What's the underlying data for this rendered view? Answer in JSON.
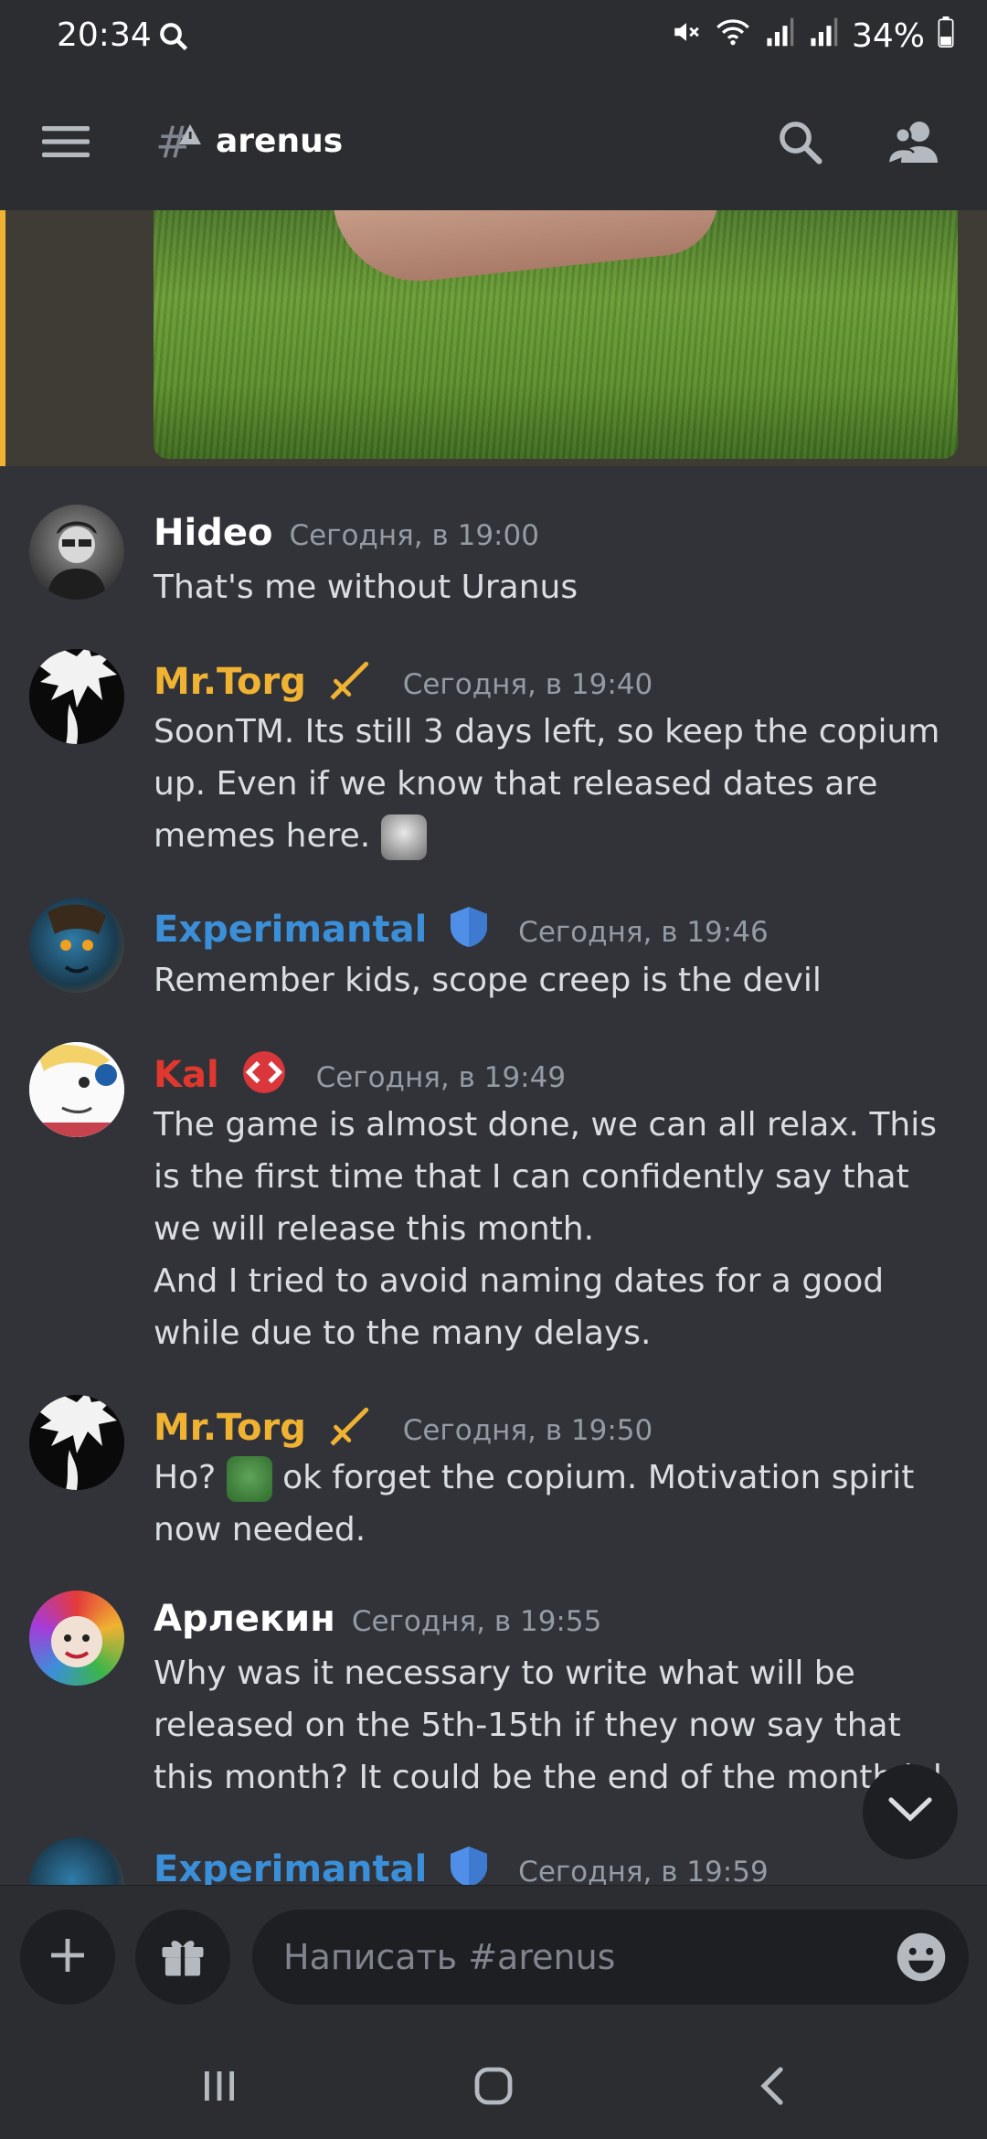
{
  "status_bar": {
    "time": "20:34",
    "battery": "34%"
  },
  "header": {
    "channel": "arenus"
  },
  "messages": [
    {
      "author": "Hideo",
      "color": "#ffffff",
      "time": "Сегодня, в 19:00",
      "lines": [
        "That's me without Uranus"
      ]
    },
    {
      "author": "Mr.Torg",
      "color": "#f0b232",
      "time": "Сегодня, в 19:40",
      "lines": [
        "SoonTM. Its still 3 days left, so keep the copium up. Even if we know that released dates are memes here."
      ]
    },
    {
      "author": "Experimantal",
      "color": "#3b8fd9",
      "time": "Сегодня, в 19:46",
      "lines": [
        "Remember kids, scope creep is the devil"
      ]
    },
    {
      "author": "Kal",
      "color": "#e0372e",
      "time": "Сегодня, в 19:49",
      "lines": [
        "The game is almost done, we can all relax. This is the first time that I can confidently say that we will release this month.",
        "And I tried to avoid naming dates for a good while due to the many delays."
      ]
    },
    {
      "author": "Mr.Torg",
      "color": "#f0b232",
      "time": "Сегодня, в 19:50",
      "lines_a": "Ho?",
      "lines_b": "ok forget the copium. Motivation spirit now needed."
    },
    {
      "author": "Арлекин",
      "color": "#ffffff",
      "time": "Сегодня, в 19:55",
      "lines": [
        "Why was it necessary to write what will be released on the 5th-15th if they now say that this month?  It could be the end of the month lol."
      ]
    },
    {
      "author": "Experimantal",
      "color": "#3b8fd9",
      "time": "Сегодня, в 19:59"
    }
  ],
  "composer": {
    "placeholder": "Написать #arenus"
  }
}
